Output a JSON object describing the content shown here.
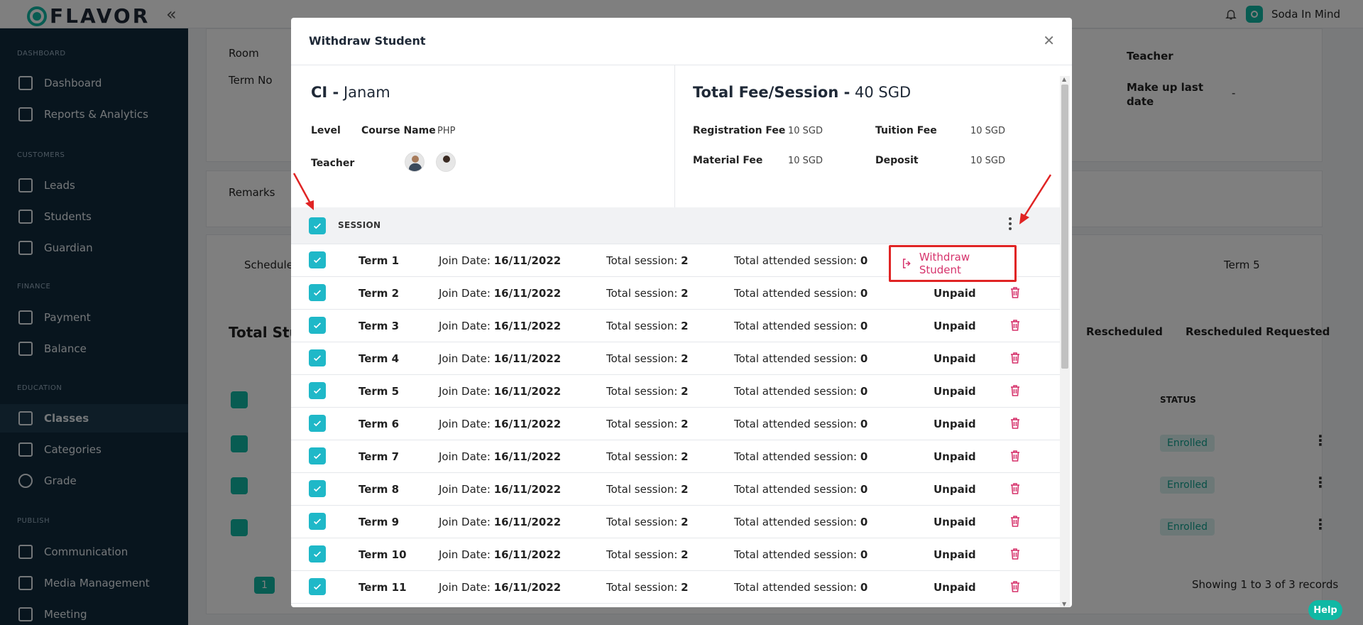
{
  "app": {
    "logo_text": "FLAVOR",
    "org_name": "Soda In Mind"
  },
  "sidebar": {
    "sections": [
      {
        "label": "DASHBOARD",
        "items": [
          "Dashboard",
          "Reports & Analytics"
        ]
      },
      {
        "label": "CUSTOMERS",
        "items": [
          "Leads",
          "Students",
          "Guardian"
        ]
      },
      {
        "label": "FINANCE",
        "items": [
          "Payment",
          "Balance"
        ]
      },
      {
        "label": "EDUCATION",
        "items": [
          "Classes",
          "Categories",
          "Grade"
        ]
      },
      {
        "label": "PUBLISH",
        "items": [
          "Communication",
          "Media Management",
          "Meeting"
        ]
      }
    ],
    "active": "Classes"
  },
  "background": {
    "room_label": "Room",
    "term_no_label": "Term No",
    "remarks_label": "Remarks",
    "schedule_label": "Schedule",
    "total_students_label": "Total Stu",
    "teacher_label": "Teacher",
    "makeup_label": "Make up last",
    "makeup_label2": "date",
    "makeup_value": "-",
    "term_select": "Term 5",
    "rescheduled": "Rescheduled",
    "rescheduled_requested": "Rescheduled Requested",
    "status_header": "STATUS",
    "enrolled": "Enrolled",
    "page_number": "1",
    "records_text": "Showing 1 to 3 of 3 records"
  },
  "modal": {
    "title": "Withdraw Student",
    "ci_label": "CI -",
    "ci_name": "Janam",
    "level_label": "Level",
    "course_name_label": "Course Name",
    "course_name_value": "PHP",
    "teacher_label": "Teacher",
    "fee_title_label": "Total Fee/Session -",
    "fee_title_value": "40 SGD",
    "registration_fee_label": "Registration Fee",
    "registration_fee_value": "10 SGD",
    "tuition_fee_label": "Tuition Fee",
    "tuition_fee_value": "10 SGD",
    "material_fee_label": "Material Fee",
    "material_fee_value": "10 SGD",
    "deposit_label": "Deposit",
    "deposit_value": "10 SGD",
    "session_header": "SESSION",
    "join_label": "Join Date:",
    "total_label": "Total session:",
    "attended_label": "Total attended session:",
    "rows": [
      {
        "term": "Term 1",
        "join": "16/11/2022",
        "total": "2",
        "attended": "0",
        "status": ""
      },
      {
        "term": "Term 2",
        "join": "16/11/2022",
        "total": "2",
        "attended": "0",
        "status": "Unpaid"
      },
      {
        "term": "Term 3",
        "join": "16/11/2022",
        "total": "2",
        "attended": "0",
        "status": "Unpaid"
      },
      {
        "term": "Term 4",
        "join": "16/11/2022",
        "total": "2",
        "attended": "0",
        "status": "Unpaid"
      },
      {
        "term": "Term 5",
        "join": "16/11/2022",
        "total": "2",
        "attended": "0",
        "status": "Unpaid"
      },
      {
        "term": "Term 6",
        "join": "16/11/2022",
        "total": "2",
        "attended": "0",
        "status": "Unpaid"
      },
      {
        "term": "Term 7",
        "join": "16/11/2022",
        "total": "2",
        "attended": "0",
        "status": "Unpaid"
      },
      {
        "term": "Term 8",
        "join": "16/11/2022",
        "total": "2",
        "attended": "0",
        "status": "Unpaid"
      },
      {
        "term": "Term 9",
        "join": "16/11/2022",
        "total": "2",
        "attended": "0",
        "status": "Unpaid"
      },
      {
        "term": "Term 10",
        "join": "16/11/2022",
        "total": "2",
        "attended": "0",
        "status": "Unpaid"
      },
      {
        "term": "Term 11",
        "join": "16/11/2022",
        "total": "2",
        "attended": "0",
        "status": "Unpaid"
      }
    ],
    "withdraw_action": "Withdraw Student"
  },
  "help_label": "Help",
  "colors": {
    "accent": "#10b8a4",
    "checkbox": "#1fb8c8",
    "danger": "#e02424",
    "withdraw_text": "#d6336c",
    "sidebar_bg": "#102a3c"
  }
}
